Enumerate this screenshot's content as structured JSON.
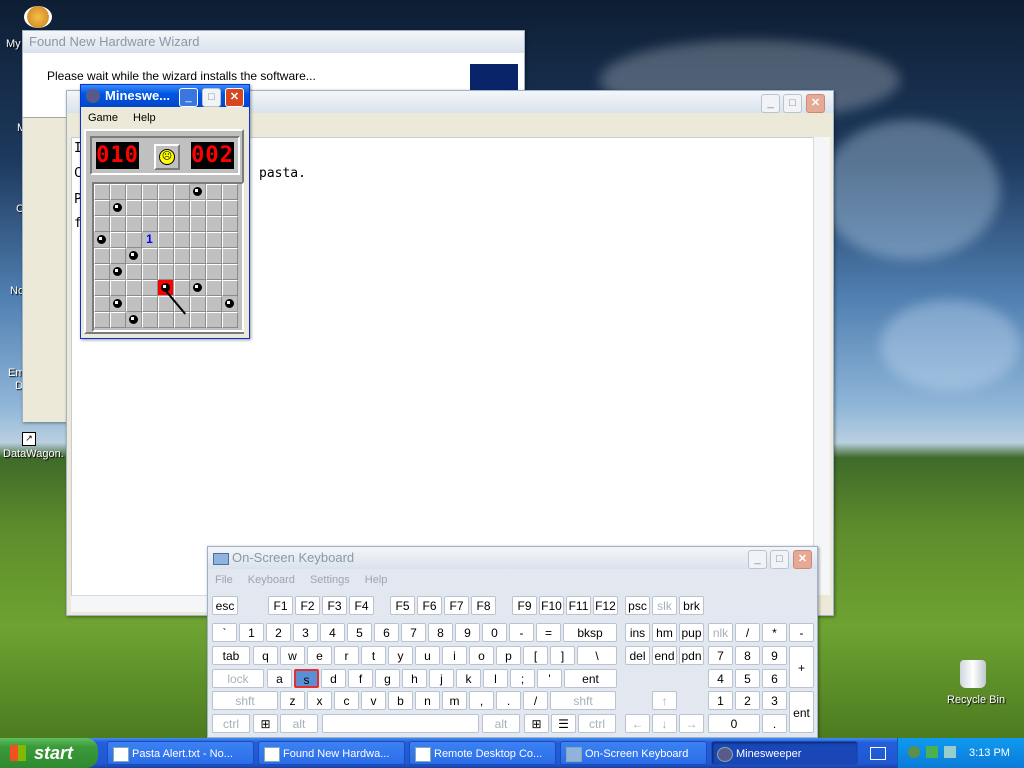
{
  "desktop": {
    "icons": [
      {
        "label": "My",
        "name": "my-computer-label"
      },
      {
        "label": "M",
        "name": "my-documents-label"
      },
      {
        "label": "C",
        "name": "c-label"
      },
      {
        "label": "No",
        "name": "network-label"
      },
      {
        "label": "Em",
        "name": "email-label"
      },
      {
        "label": "D",
        "name": "d-label"
      },
      {
        "label": "DataWagon.",
        "name": "datawagon-label"
      },
      {
        "label": "Recycle Bin",
        "name": "recycle-bin-label"
      }
    ]
  },
  "wizard": {
    "title": "Found New Hardware Wizard",
    "message": "Please wait while the wizard installs the software..."
  },
  "notepad": {
    "visible_lines": [
      "I",
      "C",
      "P",
      "f"
    ],
    "text_fragment": "pasta."
  },
  "minesweeper": {
    "title": "Mineswe...",
    "menu": [
      "Game",
      "Help"
    ],
    "mines_counter": "010",
    "time_counter": "002",
    "face": "sad",
    "number_cell": "1",
    "accent_color": "#ff0000"
  },
  "osk": {
    "title": "On-Screen Keyboard",
    "menu": [
      "File",
      "Keyboard",
      "Settings",
      "Help"
    ],
    "selected_key": "s"
  },
  "taskbar": {
    "start": "start",
    "tasks": [
      "Pasta Alert.txt - No...",
      "Found New Hardwa...",
      "Remote Desktop Co...",
      "On-Screen Keyboard",
      "Minesweeper"
    ],
    "clock": "3:13 PM"
  }
}
